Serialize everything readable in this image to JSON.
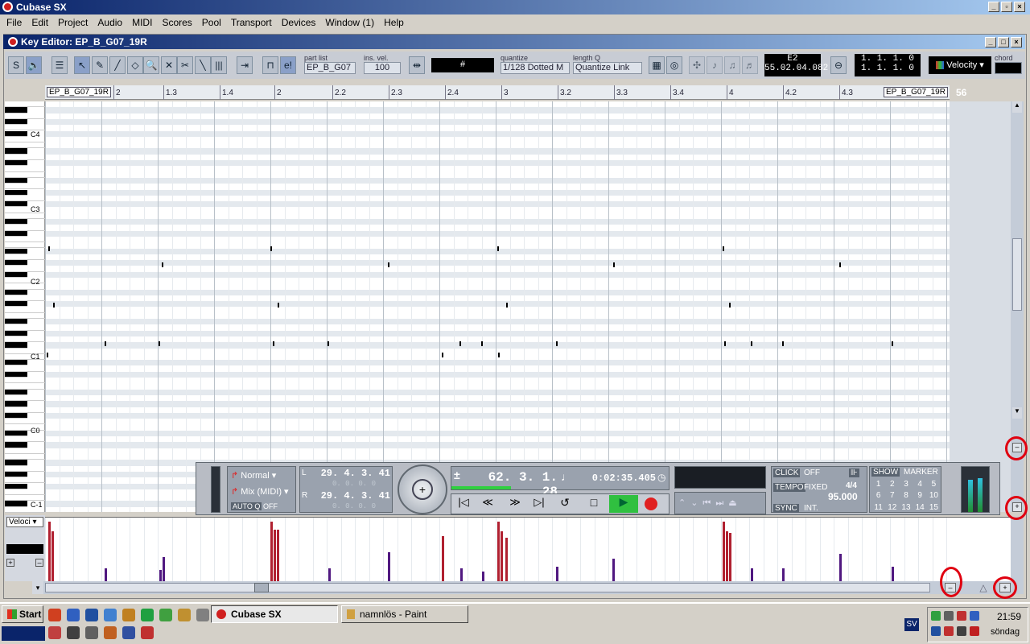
{
  "app": {
    "title": "Cubase SX",
    "menu": [
      "File",
      "Edit",
      "Project",
      "Audio",
      "MIDI",
      "Scores",
      "Pool",
      "Transport",
      "Devices",
      "Window (1)",
      "Help"
    ]
  },
  "editor": {
    "title": "Key Editor: EP_B_G07_19R",
    "part_list_label": "part list",
    "part_list_value": "EP_B_G07",
    "ins_vel_label": "ins. vel.",
    "ins_vel_value": "100",
    "grid_symbol": "#",
    "quantize_label": "quantize",
    "quantize_value": "1/128 Dotted M",
    "length_label": "length Q",
    "length_value": "Quantize Link",
    "pos_note": "E2",
    "pos_time": "55.02.04.082",
    "pos_a": "1. 1. 1.   0",
    "pos_b": "1. 1. 1.   0",
    "velocity_select": "Velocity",
    "chord_label": "chord"
  },
  "ruler": {
    "part_left": "EP_B_G07_19R",
    "part_right": "EP_B_G07_19R",
    "end_num": "56",
    "marks": [
      "2",
      "1.3",
      "1.4",
      "2",
      "2.2",
      "2.3",
      "2.4",
      "3",
      "3.2",
      "3.3",
      "3.4",
      "4",
      "4.2",
      "4.3"
    ]
  },
  "keys": {
    "labels": [
      "C4",
      "C3",
      "C2",
      "C1",
      "C0",
      "C-1"
    ]
  },
  "controller": {
    "lane_select": "Veloci"
  },
  "transport": {
    "mode": "Normal",
    "mix": "Mix (MIDI)",
    "autoq": "AUTO Q",
    "autoq_val": "OFF",
    "left_loc": "29. 4. 3. 41",
    "left_sub": "0. 0. 0.  0",
    "right_loc": "29. 4. 3. 41",
    "right_sub": "0. 0. 0.  0",
    "bars": "62. 3. 1. 28",
    "time": "0:02:35.405",
    "click_label": "CLICK",
    "click_val": "OFF",
    "tempo_label": "TEMPO",
    "tempo_mode": "FIXED",
    "signature": "4/4",
    "tempo_val": "95.000",
    "sync_label": "SYNC",
    "sync_val": "INT.",
    "show_label": "SHOW",
    "marker_label": "MARKER",
    "markers": [
      "1",
      "2",
      "3",
      "4",
      "5",
      "6",
      "7",
      "8",
      "9",
      "10",
      "11",
      "12",
      "13",
      "14",
      "15"
    ]
  },
  "taskbar": {
    "start": "Start",
    "task1": "Cubase SX",
    "task2": "namnlös - Paint",
    "lang": "SV",
    "clock": "21:59",
    "day": "söndag"
  }
}
